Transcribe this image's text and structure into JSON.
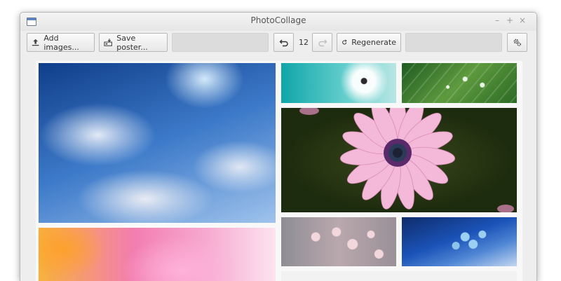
{
  "window": {
    "title": "PhotoCollage",
    "controls": [
      "–",
      "+",
      "×"
    ]
  },
  "toolbar": {
    "add_images_label": "Add images...",
    "save_poster_label": "Save poster...",
    "history_count": "12",
    "regenerate_label": "Regenerate"
  },
  "collage": {
    "tiles": [
      "sky-clouds",
      "dandelion",
      "green-leaf-drops",
      "pink-daisy",
      "cherry-blossom",
      "blue-forget-me-not",
      "pink-blur",
      "partial-strip"
    ]
  },
  "colors": {
    "window_bg": "#eeeeee",
    "canvas_bg": "#f8f8f8",
    "button_border": "#b8b8b8"
  }
}
